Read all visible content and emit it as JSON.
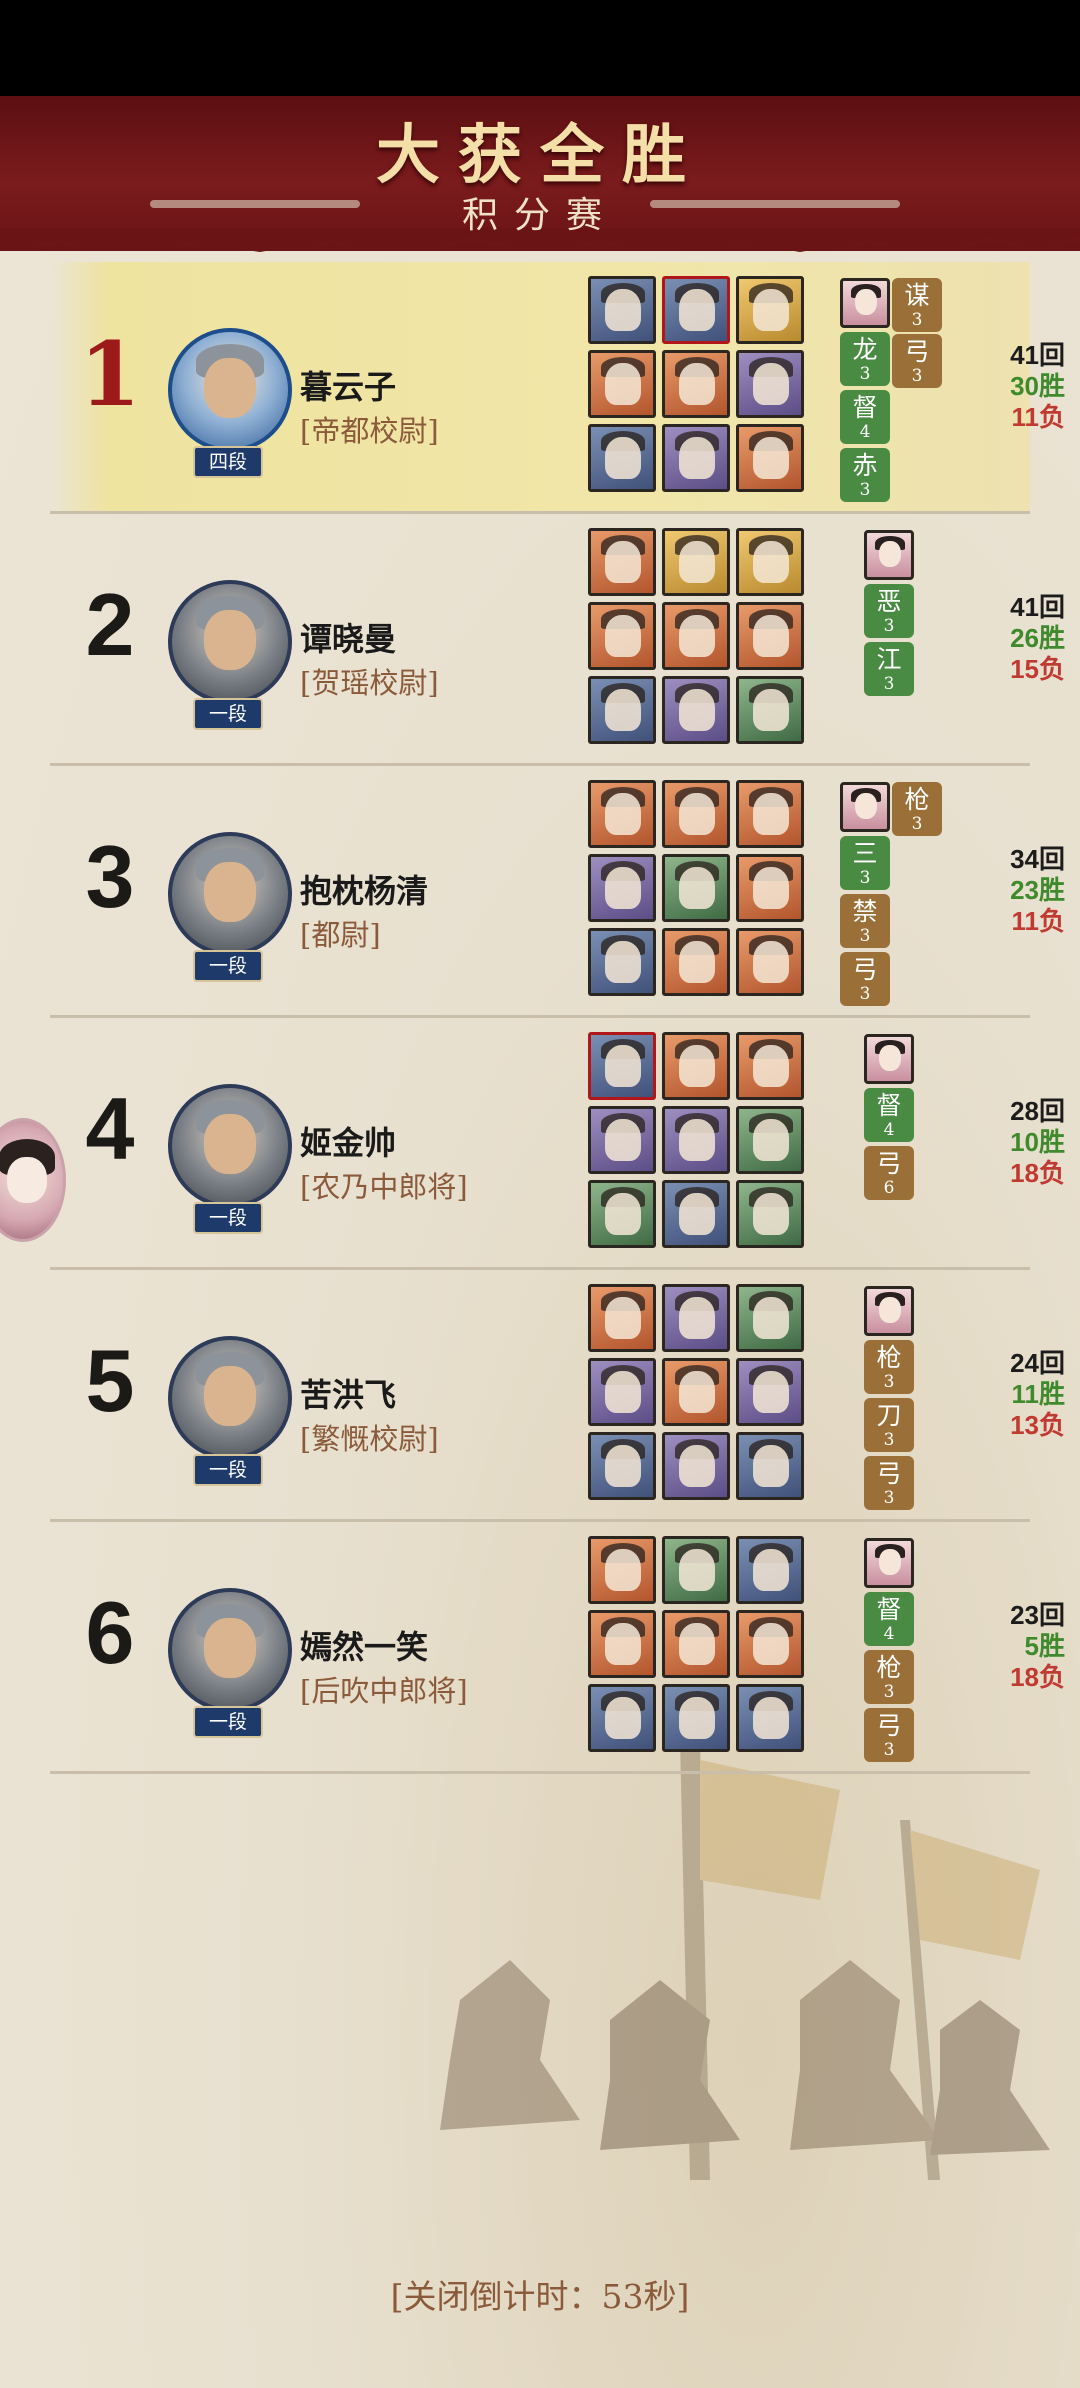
{
  "header": {
    "title": "大获全胜",
    "subtitle": "积分赛"
  },
  "rows": [
    {
      "rank": "1",
      "name": "暮云子",
      "title": "[帝都校尉]",
      "level": "四段",
      "games": "41回",
      "wins": "30胜",
      "losses": "11负",
      "tags": [
        {
          "char": "谋",
          "level": "3",
          "color": "brown"
        },
        {
          "char": "弓",
          "level": "3",
          "color": "brown"
        },
        {
          "char": "龙",
          "level": "3",
          "color": "green"
        },
        {
          "char": "督",
          "level": "4",
          "color": "green"
        },
        {
          "char": "赤",
          "level": "3",
          "color": "green"
        }
      ]
    },
    {
      "rank": "2",
      "name": "谭晓曼",
      "title": "[贺瑶校尉]",
      "level": "一段",
      "games": "41回",
      "wins": "26胜",
      "losses": "15负",
      "tags": [
        {
          "char": "恶",
          "level": "3",
          "color": "green"
        },
        {
          "char": "江",
          "level": "3",
          "color": "green"
        }
      ]
    },
    {
      "rank": "3",
      "name": "抱枕杨清",
      "title": "[都尉]",
      "level": "一段",
      "games": "34回",
      "wins": "23胜",
      "losses": "11负",
      "tags": [
        {
          "char": "枪",
          "level": "3",
          "color": "brown"
        },
        {
          "char": "三",
          "level": "3",
          "color": "green"
        },
        {
          "char": "禁",
          "level": "3",
          "color": "brown"
        },
        {
          "char": "弓",
          "level": "3",
          "color": "brown"
        }
      ]
    },
    {
      "rank": "4",
      "name": "姬金帅",
      "title": "[农乃中郎将]",
      "level": "一段",
      "games": "28回",
      "wins": "10胜",
      "losses": "18负",
      "tags": [
        {
          "char": "督",
          "level": "4",
          "color": "green"
        },
        {
          "char": "弓",
          "level": "6",
          "color": "brown"
        }
      ]
    },
    {
      "rank": "5",
      "name": "苦洪飞",
      "title": "[繁慨校尉]",
      "level": "一段",
      "games": "24回",
      "wins": "11胜",
      "losses": "13负",
      "tags": [
        {
          "char": "枪",
          "level": "3",
          "color": "brown"
        },
        {
          "char": "刀",
          "level": "3",
          "color": "brown"
        },
        {
          "char": "弓",
          "level": "3",
          "color": "brown"
        }
      ]
    },
    {
      "rank": "6",
      "name": "嫣然一笑",
      "title": "[后吹中郎将]",
      "level": "一段",
      "games": "23回",
      "wins": "5胜",
      "losses": "18负",
      "tags": [
        {
          "char": "督",
          "level": "4",
          "color": "green"
        },
        {
          "char": "枪",
          "level": "3",
          "color": "brown"
        },
        {
          "char": "弓",
          "level": "3",
          "color": "brown"
        }
      ]
    }
  ],
  "footer": {
    "countdown": "[关闭倒计时：53秒]"
  },
  "colors": {
    "banner": "#7b1b1d",
    "highlight": "#f1e6a8",
    "win": "#3f8a2c",
    "loss": "#c03a32",
    "tag_green": "#4a8b43",
    "tag_brown": "#9a7038"
  }
}
